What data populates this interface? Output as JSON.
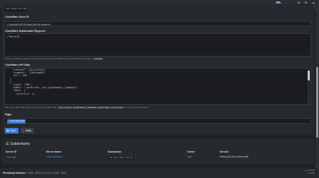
{
  "header": {
    "user_name": "plai chez"
  },
  "previous_field_value": "joe.lapin.tii.de",
  "zone_id": {
    "label": "Cloudflare Zone ID",
    "value": "f4d4a5a0fd970f9b6412b3fafe8bdefa"
  },
  "regex": {
    "label": "Cloudflare Subdomain Regexes",
    "value": "[^minor]$",
    "help_text": "This is a newline-separated array of regexes that are disallowed in subdomains. Example:",
    "example": "[^mod]$"
  },
  "api_data": {
    "label": "Cloudflare API Data",
    "lines": [
      "    \"content\": \"{ip_alias}\",",
      "    \"comment\": \"{username}\",",
      "    \"ttl\": 300",
      "  }",
      "  {",
      "    \"type\": \"SRV\",",
      "    \"name\": \"_minecraft._tcp.{subdomain}.{domain}\",",
      "    \"data\": {",
      "      \"priority\": 0,"
    ],
    "help_text_pre": "This is the data that will be sent to the Cloudflare API.",
    "help_chip": "{ip} {port} {subdomain} {domain} {username} {ip_alias}",
    "help_text_post": "for each new subdomain."
  },
  "eggs": {
    "label": "Eggs",
    "chip_label": "Java Minecraft"
  },
  "buttons": {
    "save": "Save",
    "back": "Back"
  },
  "subdomains": {
    "title": "Subdomains",
    "columns": [
      "Server ID",
      "Server Name",
      "Subdomain",
      "Owner",
      "Service"
    ],
    "rows": [
      {
        "server_id": "8a5c2a6d",
        "server_name": "Lapin Network",
        "subdomain": "ras.joe.lapin.tii.de",
        "owner": "lapin",
        "service": "Minecraft (Java Minecraft)"
      }
    ]
  },
  "footer": {
    "brand": "Pterodactyl Software",
    "years1": "© 2015 - 2023 |",
    "company": "Blueprint",
    "years2": "© 2023 - 2024",
    "version": "v. 1.11.10",
    "time": "0.03s"
  }
}
